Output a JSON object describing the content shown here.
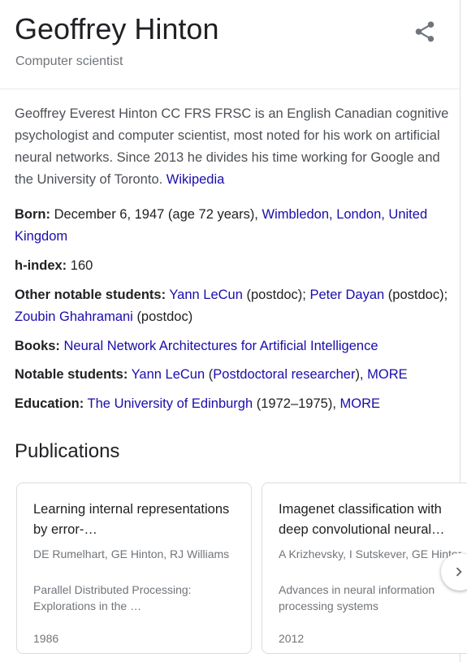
{
  "header": {
    "title": "Geoffrey Hinton",
    "subtitle": "Computer scientist",
    "share_icon": "share-icon"
  },
  "description": {
    "text": "Geoffrey Everest Hinton CC FRS FRSC is an English Canadian cognitive psychologist and computer scientist, most noted for his work on artificial neural networks. Since 2013 he divides his time working for Google and the University of Toronto.",
    "source_link": "Wikipedia"
  },
  "facts": {
    "born": {
      "label": "Born:",
      "value": "December 6, 1947 (age 72 years),",
      "place_link": "Wimbledon, London, United Kingdom"
    },
    "h_index": {
      "label": "h-index:",
      "value": "160"
    },
    "other_students": {
      "label": "Other notable students:",
      "student1": "Yann LeCun",
      "student1_role": "(postdoc);",
      "student2": "Peter Dayan",
      "student2_role": "(postdoc);",
      "student3": "Zoubin Ghahramani",
      "student3_role": "(postdoc)"
    },
    "books": {
      "label": "Books:",
      "book1": "Neural Network Architectures for Artificial Intelligence"
    },
    "notable_students": {
      "label": "Notable students:",
      "student1": "Yann LeCun",
      "open_paren": "(",
      "role_link": "Postdoctoral researcher",
      "close_paren": "),",
      "more": "MORE"
    },
    "education": {
      "label": "Education:",
      "school": "The University of Edinburgh",
      "years": "(1972–1975),",
      "more": "MORE"
    }
  },
  "publications": {
    "heading": "Publications",
    "cards": [
      {
        "title": "Learning internal representations by error-…",
        "authors": "DE Rumelhart, GE Hinton, RJ Williams",
        "venue": "Parallel Distributed Processing: Explorations in the …",
        "year": "1986"
      },
      {
        "title": "Imagenet classification with deep convolutional neural…",
        "authors": "A Krizhevsky, I Sutskever, GE Hinton",
        "venue": "Advances in neural information processing systems",
        "year": "2012"
      }
    ],
    "next_icon": "chevron-right-icon"
  }
}
